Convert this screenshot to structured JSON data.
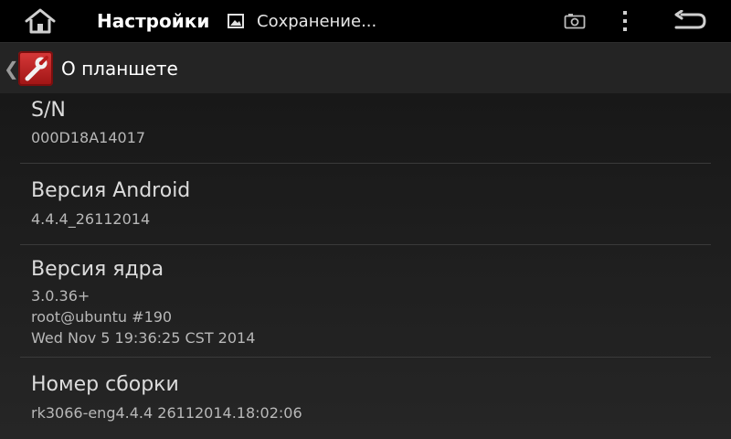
{
  "status_bar": {
    "app_title": "Настройки",
    "notification_text": "Сохранение...",
    "icons": [
      "home-icon",
      "image-icon",
      "screenshot-icon",
      "overflow-menu-icon",
      "back-icon"
    ]
  },
  "action_bar": {
    "title": "О планшете",
    "icons": [
      "caret-left-icon",
      "settings-wrench-icon"
    ]
  },
  "preferences": [
    {
      "title": "S/N",
      "summary": "000D18A14017"
    },
    {
      "title": "Версия Android",
      "summary": "4.4.4_26112014"
    },
    {
      "title": "Версия ядра",
      "summary_lines": [
        "3.0.36+",
        "root@ubuntu #190",
        "Wed Nov 5 19:36:25 CST 2014"
      ]
    },
    {
      "title": "Номер сборки",
      "summary": "rk3066-eng4.4.4 26112014.18:02:06"
    }
  ],
  "colors": {
    "status_bar_bg": "#000000",
    "action_bar_bg": "#242424",
    "list_bg": "#1e1e1e",
    "text_primary": "#dcdcdc",
    "text_secondary": "#b8b8b8",
    "app_icon": "#c62828"
  }
}
